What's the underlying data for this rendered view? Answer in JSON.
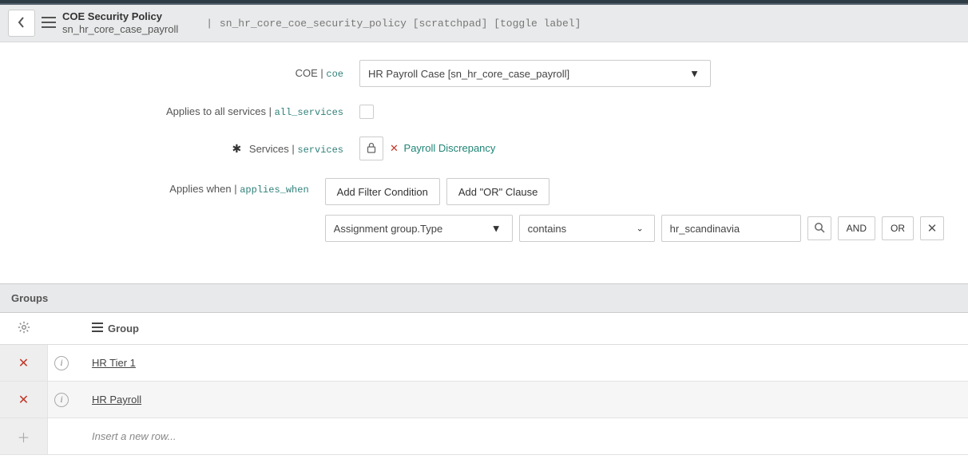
{
  "header": {
    "title": "COE Security Policy",
    "subtitle": "sn_hr_core_case_payroll",
    "table": "sn_hr_core_coe_security_policy",
    "scratchpad": "[scratchpad]",
    "toggle_label": "[toggle label]"
  },
  "form": {
    "coe": {
      "label": "COE",
      "tech": "coe",
      "value": "HR Payroll Case [sn_hr_core_case_payroll]"
    },
    "all_services": {
      "label": "Applies to all services",
      "tech": "all_services"
    },
    "services": {
      "label": "Services",
      "tech": "services",
      "tag": "Payroll Discrepancy"
    },
    "applies_when": {
      "label": "Applies when",
      "tech": "applies_when",
      "add_filter": "Add Filter Condition",
      "add_or": "Add \"OR\" Clause",
      "condition": {
        "field": "Assignment group.Type",
        "operator": "contains",
        "value": "hr_scandinavia",
        "and_label": "AND",
        "or_label": "OR"
      }
    }
  },
  "groups": {
    "section_label": "Groups",
    "column_name": "Group",
    "rows": [
      {
        "name": "HR Tier 1"
      },
      {
        "name": "HR Payroll"
      }
    ],
    "insert_placeholder": "Insert a new row..."
  }
}
